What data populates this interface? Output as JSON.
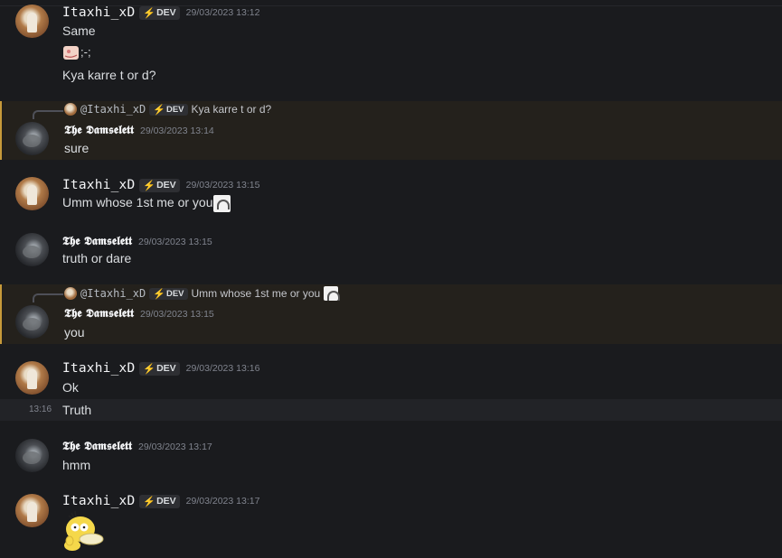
{
  "users": {
    "itaxhi": "Itaxhi_xD",
    "damselett": "𝕿𝖍𝖊 𝕯𝖆𝖒𝖘𝖊𝖑𝖊𝖙𝖙",
    "badge": "DEV",
    "reply_mention_itaxhi": "@Itaxhi_xD"
  },
  "colors": {
    "highlight_bar": "#c79a3a",
    "badge_bolt": "#f0b232",
    "background": "#1a1b1e"
  },
  "messages": [
    {
      "id": "m1",
      "author": "Itaxhi_xD",
      "timestamp": "29/03/2023 13:12",
      "lines": [
        "Same",
        ";-;",
        "Kya karre t or d?"
      ]
    },
    {
      "id": "m2",
      "author": "damselett",
      "timestamp": "29/03/2023 13:14",
      "reply_to": "Kya karre t or d?",
      "text": "sure"
    },
    {
      "id": "m3",
      "author": "Itaxhi_xD",
      "timestamp": "29/03/2023 13:15",
      "text": "Umm whose 1st me or you"
    },
    {
      "id": "m4",
      "author": "damselett",
      "timestamp": "29/03/2023 13:15",
      "text": "truth or dare"
    },
    {
      "id": "m5",
      "author": "damselett",
      "timestamp": "29/03/2023 13:15",
      "reply_to": "Umm whose 1st me or you",
      "text": "you"
    },
    {
      "id": "m6",
      "author": "Itaxhi_xD",
      "timestamp": "29/03/2023 13:16",
      "text": "Ok",
      "followup_time": "13:16",
      "followup": "Truth"
    },
    {
      "id": "m7",
      "author": "damselett",
      "timestamp": "29/03/2023 13:17",
      "text": "hmm"
    },
    {
      "id": "m8",
      "author": "Itaxhi_xD",
      "timestamp": "29/03/2023 13:17",
      "sticker": "psyduck-sticker"
    }
  ]
}
